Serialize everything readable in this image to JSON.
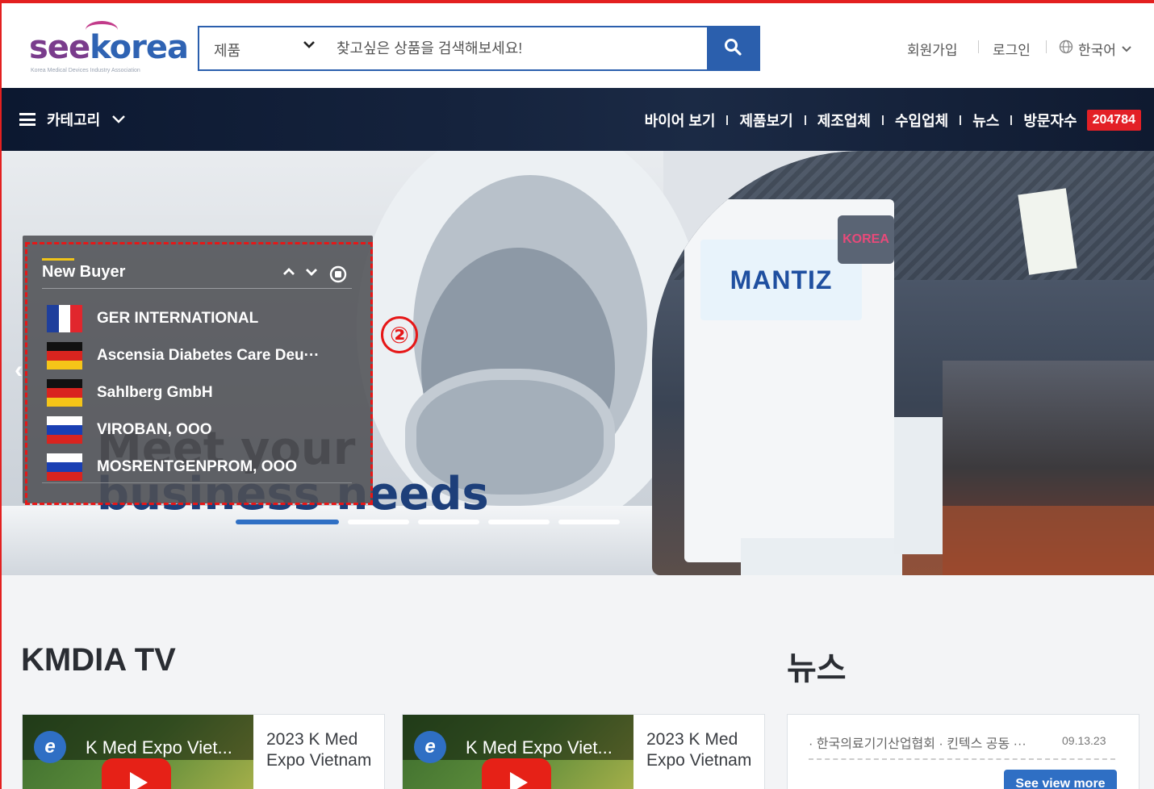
{
  "header": {
    "logo_text_see": "see",
    "logo_text_korea": "korea",
    "logo_subtitle": "Korea Medical Devices Industry Association",
    "search": {
      "category": "제품",
      "placeholder": "찾고싶은 상품을 검색해보세요!"
    },
    "util": {
      "signup": "회원가입",
      "login": "로그인",
      "language": "한국어"
    }
  },
  "nav": {
    "category_label": "카테고리",
    "links": [
      "바이어 보기",
      "제품보기",
      "제조업체",
      "수입업체",
      "뉴스",
      "방문자수"
    ],
    "visitor_count": "204784"
  },
  "hero": {
    "title_line1": "Meet your",
    "title_line2": "business needs",
    "booth_logo": "MANTIZ",
    "booth_korea": "KOREA",
    "slides_total": 5,
    "active_slide": 1
  },
  "new_buyer": {
    "title": "New Buyer",
    "annotation": "②",
    "items": [
      {
        "flag": "france",
        "name": "GER INTERNATIONAL"
      },
      {
        "flag": "germany",
        "name": "Ascensia Diabetes Care Deu···"
      },
      {
        "flag": "germany",
        "name": "Sahlberg GmbH"
      },
      {
        "flag": "russia",
        "name": "VIROBAN, OOO"
      },
      {
        "flag": "russia",
        "name": "MOSRENTGENPROM, OOO"
      }
    ]
  },
  "kmdia_tv": {
    "title": "KMDIA TV",
    "videos": [
      {
        "thumb_title": "K Med Expo Viet...",
        "caption": "2023 K Med Expo Vietnam"
      },
      {
        "thumb_title": "K Med Expo Viet...",
        "caption": "2023 K Med Expo Vietnam"
      }
    ]
  },
  "news": {
    "title": "뉴스",
    "item": "· 한국의료기기산업협회 · 킨텍스 공동 ···",
    "date": "09.13.23",
    "see_more": "See view more"
  },
  "colors": {
    "brand_blue": "#2b5fad",
    "visitor_badge": "#e32026",
    "annotation_red": "#e61717",
    "nav_bg": "#0c1830"
  },
  "icons": [
    "search-icon",
    "chevron-down-icon",
    "globe-icon",
    "hamburger-icon",
    "chevron-up-icon",
    "pause-icon",
    "prev-arrow-icon",
    "play-icon"
  ]
}
